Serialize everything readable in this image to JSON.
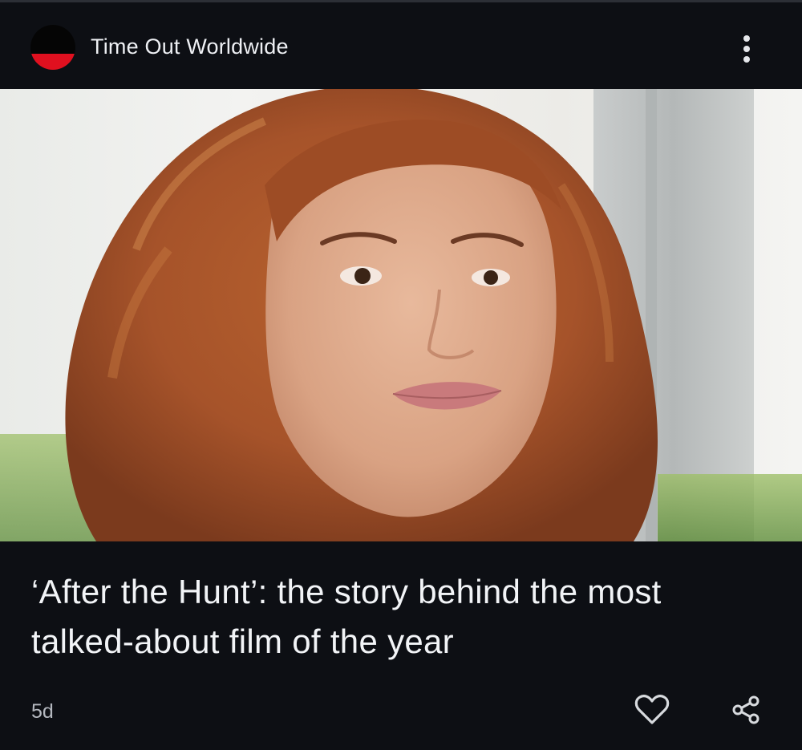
{
  "card": {
    "source": {
      "name": "Time Out Worldwide",
      "logo_colors": {
        "top": "#050505",
        "bottom": "#e0101f"
      }
    },
    "menu_icon": "more-vertical-icon",
    "image": {
      "subject": "portrait photo of a smiling woman with shoulder-length auburn hair"
    },
    "headline": "‘After the Hunt’: the story behind the most talked-about film of the year",
    "age": "5d",
    "actions": {
      "like_icon": "heart-icon",
      "share_icon": "share-icon"
    }
  },
  "colors": {
    "background": "#0d0f14",
    "text_primary": "#f2f4f7",
    "text_secondary": "#b4b8bf"
  }
}
